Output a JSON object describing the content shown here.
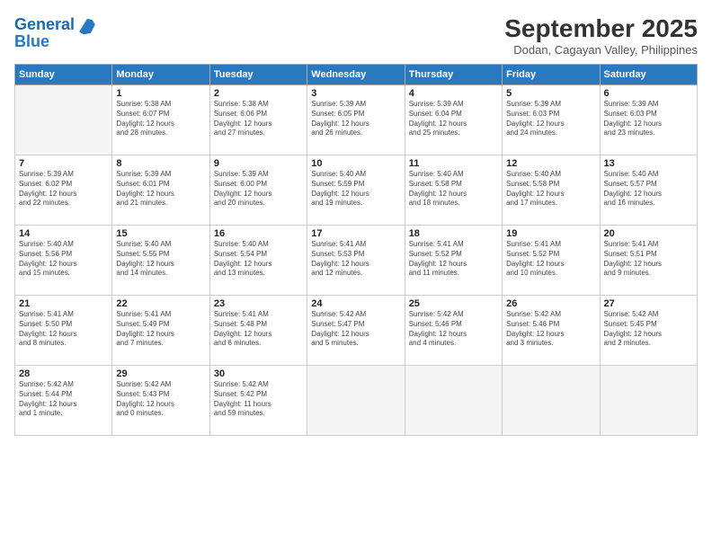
{
  "header": {
    "logo_line1": "General",
    "logo_line2": "Blue",
    "month_title": "September 2025",
    "location": "Dodan, Cagayan Valley, Philippines"
  },
  "weekdays": [
    "Sunday",
    "Monday",
    "Tuesday",
    "Wednesday",
    "Thursday",
    "Friday",
    "Saturday"
  ],
  "weeks": [
    [
      {
        "day": "",
        "info": ""
      },
      {
        "day": "1",
        "info": "Sunrise: 5:38 AM\nSunset: 6:07 PM\nDaylight: 12 hours\nand 28 minutes."
      },
      {
        "day": "2",
        "info": "Sunrise: 5:38 AM\nSunset: 6:06 PM\nDaylight: 12 hours\nand 27 minutes."
      },
      {
        "day": "3",
        "info": "Sunrise: 5:39 AM\nSunset: 6:05 PM\nDaylight: 12 hours\nand 26 minutes."
      },
      {
        "day": "4",
        "info": "Sunrise: 5:39 AM\nSunset: 6:04 PM\nDaylight: 12 hours\nand 25 minutes."
      },
      {
        "day": "5",
        "info": "Sunrise: 5:39 AM\nSunset: 6:03 PM\nDaylight: 12 hours\nand 24 minutes."
      },
      {
        "day": "6",
        "info": "Sunrise: 5:39 AM\nSunset: 6:03 PM\nDaylight: 12 hours\nand 23 minutes."
      }
    ],
    [
      {
        "day": "7",
        "info": "Sunrise: 5:39 AM\nSunset: 6:02 PM\nDaylight: 12 hours\nand 22 minutes."
      },
      {
        "day": "8",
        "info": "Sunrise: 5:39 AM\nSunset: 6:01 PM\nDaylight: 12 hours\nand 21 minutes."
      },
      {
        "day": "9",
        "info": "Sunrise: 5:39 AM\nSunset: 6:00 PM\nDaylight: 12 hours\nand 20 minutes."
      },
      {
        "day": "10",
        "info": "Sunrise: 5:40 AM\nSunset: 5:59 PM\nDaylight: 12 hours\nand 19 minutes."
      },
      {
        "day": "11",
        "info": "Sunrise: 5:40 AM\nSunset: 5:58 PM\nDaylight: 12 hours\nand 18 minutes."
      },
      {
        "day": "12",
        "info": "Sunrise: 5:40 AM\nSunset: 5:58 PM\nDaylight: 12 hours\nand 17 minutes."
      },
      {
        "day": "13",
        "info": "Sunrise: 5:40 AM\nSunset: 5:57 PM\nDaylight: 12 hours\nand 16 minutes."
      }
    ],
    [
      {
        "day": "14",
        "info": "Sunrise: 5:40 AM\nSunset: 5:56 PM\nDaylight: 12 hours\nand 15 minutes."
      },
      {
        "day": "15",
        "info": "Sunrise: 5:40 AM\nSunset: 5:55 PM\nDaylight: 12 hours\nand 14 minutes."
      },
      {
        "day": "16",
        "info": "Sunrise: 5:40 AM\nSunset: 5:54 PM\nDaylight: 12 hours\nand 13 minutes."
      },
      {
        "day": "17",
        "info": "Sunrise: 5:41 AM\nSunset: 5:53 PM\nDaylight: 12 hours\nand 12 minutes."
      },
      {
        "day": "18",
        "info": "Sunrise: 5:41 AM\nSunset: 5:52 PM\nDaylight: 12 hours\nand 11 minutes."
      },
      {
        "day": "19",
        "info": "Sunrise: 5:41 AM\nSunset: 5:52 PM\nDaylight: 12 hours\nand 10 minutes."
      },
      {
        "day": "20",
        "info": "Sunrise: 5:41 AM\nSunset: 5:51 PM\nDaylight: 12 hours\nand 9 minutes."
      }
    ],
    [
      {
        "day": "21",
        "info": "Sunrise: 5:41 AM\nSunset: 5:50 PM\nDaylight: 12 hours\nand 8 minutes."
      },
      {
        "day": "22",
        "info": "Sunrise: 5:41 AM\nSunset: 5:49 PM\nDaylight: 12 hours\nand 7 minutes."
      },
      {
        "day": "23",
        "info": "Sunrise: 5:41 AM\nSunset: 5:48 PM\nDaylight: 12 hours\nand 6 minutes."
      },
      {
        "day": "24",
        "info": "Sunrise: 5:42 AM\nSunset: 5:47 PM\nDaylight: 12 hours\nand 5 minutes."
      },
      {
        "day": "25",
        "info": "Sunrise: 5:42 AM\nSunset: 5:46 PM\nDaylight: 12 hours\nand 4 minutes."
      },
      {
        "day": "26",
        "info": "Sunrise: 5:42 AM\nSunset: 5:46 PM\nDaylight: 12 hours\nand 3 minutes."
      },
      {
        "day": "27",
        "info": "Sunrise: 5:42 AM\nSunset: 5:45 PM\nDaylight: 12 hours\nand 2 minutes."
      }
    ],
    [
      {
        "day": "28",
        "info": "Sunrise: 5:42 AM\nSunset: 5:44 PM\nDaylight: 12 hours\nand 1 minute."
      },
      {
        "day": "29",
        "info": "Sunrise: 5:42 AM\nSunset: 5:43 PM\nDaylight: 12 hours\nand 0 minutes."
      },
      {
        "day": "30",
        "info": "Sunrise: 5:42 AM\nSunset: 5:42 PM\nDaylight: 11 hours\nand 59 minutes."
      },
      {
        "day": "",
        "info": ""
      },
      {
        "day": "",
        "info": ""
      },
      {
        "day": "",
        "info": ""
      },
      {
        "day": "",
        "info": ""
      }
    ]
  ]
}
